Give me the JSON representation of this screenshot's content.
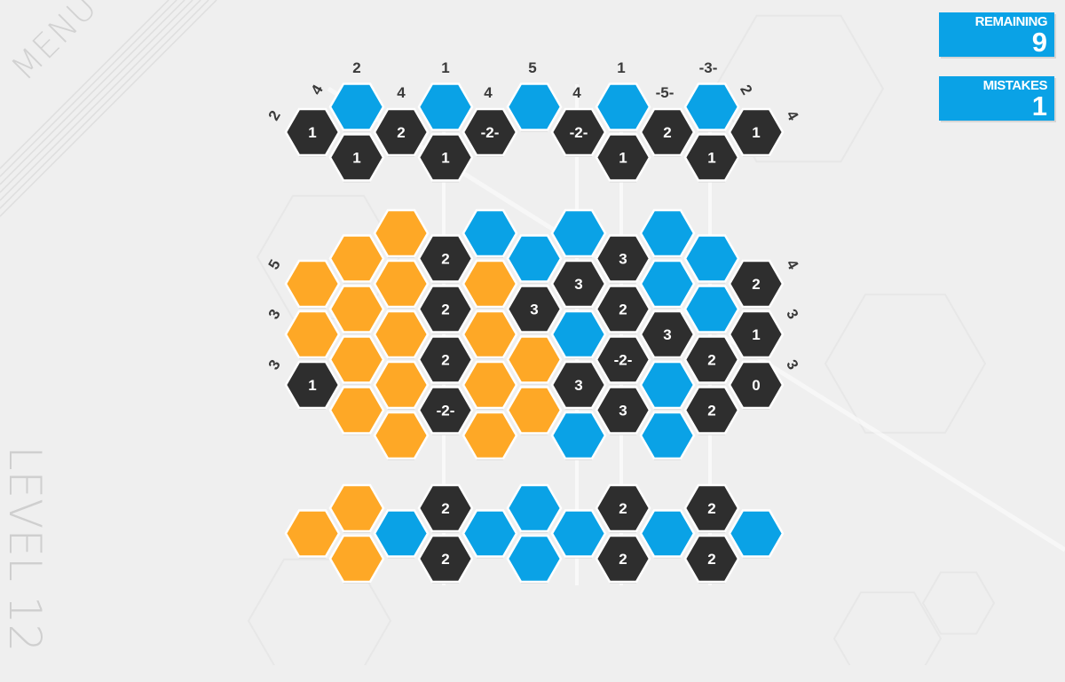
{
  "menu_label": "MENU",
  "level_label": "LEVEL 12",
  "status": {
    "remaining_label": "REMAINING",
    "remaining_value": "9",
    "mistakes_label": "MISTAKES",
    "mistakes_value": "1"
  },
  "colors": {
    "blue": "#0aa2e6",
    "orange": "#fea826",
    "dark": "#2e2e2e",
    "background": "#efefef"
  },
  "column_clues": [
    "2",
    "1",
    "5",
    "1",
    "-3-"
  ],
  "row_clues_top_left": [
    "4",
    "2"
  ],
  "row_clues_top_right": [
    "2",
    "4"
  ],
  "row_clues_mid_left": [
    "5",
    "3",
    "3"
  ],
  "row_clues_mid_right": [
    "4",
    "3",
    "3"
  ],
  "top_board": {
    "clues": [
      "4",
      "4",
      "4",
      "-5-"
    ],
    "cells": [
      {
        "col": 1,
        "row": 1,
        "state": "blue",
        "label": ""
      },
      {
        "col": 3,
        "row": 1,
        "state": "blue",
        "label": ""
      },
      {
        "col": 5,
        "row": 1,
        "state": "blue",
        "label": ""
      },
      {
        "col": 7,
        "row": 1,
        "state": "blue",
        "label": ""
      },
      {
        "col": 9,
        "row": 1,
        "state": "blue",
        "label": ""
      },
      {
        "col": 0,
        "row": 2,
        "state": "dark",
        "label": "1"
      },
      {
        "col": 2,
        "row": 2,
        "state": "dark",
        "label": "2"
      },
      {
        "col": 4,
        "row": 2,
        "state": "dark",
        "label": "-2-"
      },
      {
        "col": 6,
        "row": 2,
        "state": "dark",
        "label": "-2-"
      },
      {
        "col": 8,
        "row": 2,
        "state": "dark",
        "label": "2"
      },
      {
        "col": 10,
        "row": 2,
        "state": "dark",
        "label": "1"
      },
      {
        "col": 1,
        "row": 3,
        "state": "dark",
        "label": "1"
      },
      {
        "col": 3,
        "row": 3,
        "state": "dark",
        "label": "1"
      },
      {
        "col": 7,
        "row": 3,
        "state": "dark",
        "label": "1"
      },
      {
        "col": 9,
        "row": 3,
        "state": "dark",
        "label": "1"
      }
    ]
  },
  "middle_board": {
    "cells": [
      {
        "col": 2,
        "row": 0,
        "state": "orange",
        "label": ""
      },
      {
        "col": 4,
        "row": 0,
        "state": "blue",
        "label": ""
      },
      {
        "col": 6,
        "row": 0,
        "state": "blue",
        "label": ""
      },
      {
        "col": 8,
        "row": 0,
        "state": "blue",
        "label": ""
      },
      {
        "col": 1,
        "row": 1,
        "state": "orange",
        "label": ""
      },
      {
        "col": 3,
        "row": 1,
        "state": "dark",
        "label": "2"
      },
      {
        "col": 5,
        "row": 1,
        "state": "blue",
        "label": ""
      },
      {
        "col": 7,
        "row": 1,
        "state": "dark",
        "label": "3"
      },
      {
        "col": 9,
        "row": 1,
        "state": "blue",
        "label": ""
      },
      {
        "col": 0,
        "row": 2,
        "state": "orange",
        "label": ""
      },
      {
        "col": 2,
        "row": 2,
        "state": "orange",
        "label": ""
      },
      {
        "col": 4,
        "row": 2,
        "state": "orange",
        "label": ""
      },
      {
        "col": 6,
        "row": 2,
        "state": "dark",
        "label": "3"
      },
      {
        "col": 8,
        "row": 2,
        "state": "blue",
        "label": ""
      },
      {
        "col": 10,
        "row": 2,
        "state": "dark",
        "label": "2"
      },
      {
        "col": 1,
        "row": 3,
        "state": "orange",
        "label": ""
      },
      {
        "col": 3,
        "row": 3,
        "state": "dark",
        "label": "2"
      },
      {
        "col": 5,
        "row": 3,
        "state": "dark",
        "label": "3"
      },
      {
        "col": 7,
        "row": 3,
        "state": "dark",
        "label": "2"
      },
      {
        "col": 9,
        "row": 3,
        "state": "blue",
        "label": ""
      },
      {
        "col": 0,
        "row": 4,
        "state": "orange",
        "label": ""
      },
      {
        "col": 2,
        "row": 4,
        "state": "orange",
        "label": ""
      },
      {
        "col": 4,
        "row": 4,
        "state": "orange",
        "label": ""
      },
      {
        "col": 6,
        "row": 4,
        "state": "blue",
        "label": ""
      },
      {
        "col": 8,
        "row": 4,
        "state": "dark",
        "label": "3"
      },
      {
        "col": 10,
        "row": 4,
        "state": "dark",
        "label": "1"
      },
      {
        "col": 1,
        "row": 5,
        "state": "orange",
        "label": ""
      },
      {
        "col": 3,
        "row": 5,
        "state": "dark",
        "label": "2"
      },
      {
        "col": 5,
        "row": 5,
        "state": "orange",
        "label": ""
      },
      {
        "col": 7,
        "row": 5,
        "state": "dark",
        "label": "-2-"
      },
      {
        "col": 9,
        "row": 5,
        "state": "dark",
        "label": "2"
      },
      {
        "col": 0,
        "row": 6,
        "state": "dark",
        "label": "1"
      },
      {
        "col": 2,
        "row": 6,
        "state": "orange",
        "label": ""
      },
      {
        "col": 4,
        "row": 6,
        "state": "orange",
        "label": ""
      },
      {
        "col": 6,
        "row": 6,
        "state": "dark",
        "label": "3"
      },
      {
        "col": 8,
        "row": 6,
        "state": "blue",
        "label": ""
      },
      {
        "col": 10,
        "row": 6,
        "state": "dark",
        "label": "0"
      },
      {
        "col": 1,
        "row": 7,
        "state": "orange",
        "label": ""
      },
      {
        "col": 3,
        "row": 7,
        "state": "dark",
        "label": "-2-"
      },
      {
        "col": 5,
        "row": 7,
        "state": "orange",
        "label": ""
      },
      {
        "col": 7,
        "row": 7,
        "state": "dark",
        "label": "3"
      },
      {
        "col": 9,
        "row": 7,
        "state": "dark",
        "label": "2"
      },
      {
        "col": 2,
        "row": 8,
        "state": "orange",
        "label": ""
      },
      {
        "col": 4,
        "row": 8,
        "state": "orange",
        "label": ""
      },
      {
        "col": 6,
        "row": 8,
        "state": "blue",
        "label": ""
      },
      {
        "col": 8,
        "row": 8,
        "state": "blue",
        "label": ""
      }
    ]
  },
  "bottom_board": {
    "cells": [
      {
        "col": 1,
        "row": 0,
        "state": "orange",
        "label": ""
      },
      {
        "col": 3,
        "row": 0,
        "state": "dark",
        "label": "2"
      },
      {
        "col": 5,
        "row": 0,
        "state": "blue",
        "label": ""
      },
      {
        "col": 7,
        "row": 0,
        "state": "dark",
        "label": "2"
      },
      {
        "col": 9,
        "row": 0,
        "state": "dark",
        "label": "2"
      },
      {
        "col": 0,
        "row": 1,
        "state": "orange",
        "label": ""
      },
      {
        "col": 2,
        "row": 1,
        "state": "blue",
        "label": ""
      },
      {
        "col": 4,
        "row": 1,
        "state": "blue",
        "label": ""
      },
      {
        "col": 6,
        "row": 1,
        "state": "blue",
        "label": ""
      },
      {
        "col": 8,
        "row": 1,
        "state": "blue",
        "label": ""
      },
      {
        "col": 10,
        "row": 1,
        "state": "blue",
        "label": ""
      },
      {
        "col": 1,
        "row": 2,
        "state": "orange",
        "label": ""
      },
      {
        "col": 3,
        "row": 2,
        "state": "dark",
        "label": "2"
      },
      {
        "col": 5,
        "row": 2,
        "state": "blue",
        "label": ""
      },
      {
        "col": 7,
        "row": 2,
        "state": "dark",
        "label": "2"
      },
      {
        "col": 9,
        "row": 2,
        "state": "dark",
        "label": "2"
      }
    ]
  }
}
